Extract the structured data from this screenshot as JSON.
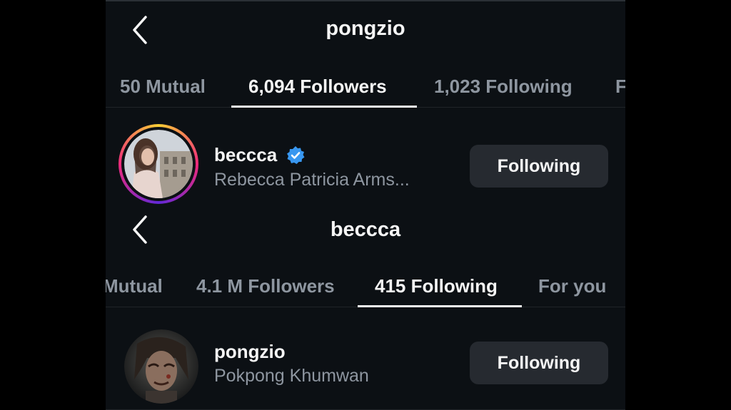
{
  "screen1": {
    "title": "pongzio",
    "tabs": [
      {
        "label": "50 Mutual"
      },
      {
        "label": "6,094 Followers",
        "active": true
      },
      {
        "label": "1,023 Following"
      },
      {
        "label": "F"
      }
    ],
    "user": {
      "username": "beccca",
      "full_name": "Rebecca Patricia Arms...",
      "verified": true,
      "button_label": "Following"
    }
  },
  "screen2": {
    "title": "beccca",
    "tabs": [
      {
        "label": "Mutual"
      },
      {
        "label": "4.1 M Followers"
      },
      {
        "label": "415 Following",
        "active": true
      },
      {
        "label": "For you"
      }
    ],
    "user": {
      "username": "pongzio",
      "full_name": "Pokpong Khumwan",
      "button_label": "Following"
    }
  },
  "colors": {
    "background": "#0c1014",
    "button": "#262a30",
    "muted_text": "#8e96a0",
    "verified_blue": "#3897f0",
    "story_ring": [
      "#f9ce34",
      "#ee2a7b",
      "#6228d7"
    ]
  },
  "icons": {
    "back": "chevron-left-icon",
    "verified": "verified-badge-icon"
  }
}
